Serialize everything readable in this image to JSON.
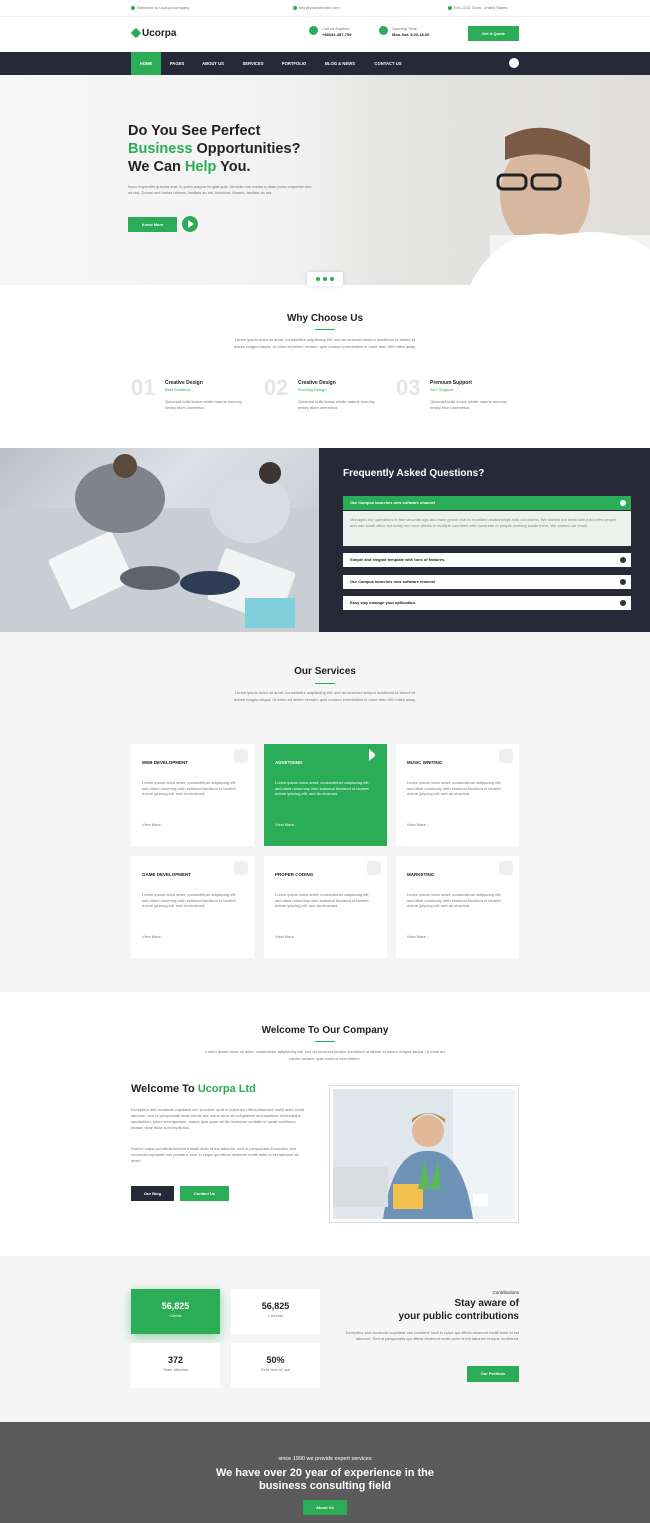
{
  "topbar": {
    "welcome": "Welcome to Ucorpa company",
    "email": "info@yourwebsite.com",
    "address": "Ext-1232, Dock, United States"
  },
  "header": {
    "logo_text": "Ucorpa",
    "call_label": "Call us Anytime",
    "call_value": "+88032-487-799",
    "time_label": "Opening Time",
    "time_value": "Mon-Sat: 9.00-18.00",
    "quote_button": "Get A Quote"
  },
  "nav": {
    "items": [
      "HOME",
      "PAGES",
      "ABOUT US",
      "SERVICES",
      "PORTFOLIO",
      "BLOG & NEWS",
      "CONTACT US"
    ]
  },
  "hero": {
    "line1": "Do You See Perfect",
    "line2_green": "Business",
    "line2_rest": " Opportunities?",
    "line3_a": "We Can ",
    "line3_green": "Help",
    "line3_b": " You.",
    "paragraph": "Nunc imperdiet gravida erat, in porta magna feugiat quis. Aenean non metus a diam porta vulputate nec sit nisi. Donec sed varius ultrices, facilisis ac est, tincidunt, Mauris, facilisis ac est.",
    "know_more": "Know More"
  },
  "why": {
    "title": "Why Choose Us",
    "paragraph": "Lorem ipsum dolor sit amet, consectetur adipisicing elit, sed do eiusmod tempor incididunt ut labore et dolore magna aliqua. Ut enim ad minim veniam, quis nostrud exercitation in more than 800 miles away.",
    "features": [
      {
        "num": "01",
        "title": "Creative Design",
        "sub": "Best Solutions",
        "text": "Quismad nulls lectus mielle mauris eonumy nestry blum onemetus"
      },
      {
        "num": "02",
        "title": "Creative Design",
        "sub": "Running Design",
        "text": "Quismad nulls lectus mielle mauris eonumy nestry blum onemetus"
      },
      {
        "num": "03",
        "title": "Premium Support",
        "sub": "24/7 Support",
        "text": "Quismad nulls lectus mielle mauris eonumy nestry blum onemetus"
      }
    ]
  },
  "faq": {
    "title": "Frequently Asked Questions?",
    "items": [
      "Our Campus launches new software channel",
      "Simple and elegant template with tons of features.",
      "Our Campus launches new software channel",
      "Easy way manage your apllication."
    ],
    "open_answer": "Managed our operations in few seconds ago and have grown due to excellent relationships with our clients. We started out small with just a few people and one small office but today we have offices in multiple countries with hundreds of people working inside them. We started out small."
  },
  "services": {
    "title": "Our Services",
    "paragraph": "Lorem ipsum dolor sit amet, consectetur adipisicing elit, sed do eiusmod tempor incididunt ut labore et dolore magna aliqua. Ut enim ad minim veniam, quis nostrud exercitation in more than 800 miles away.",
    "cards": [
      {
        "title": "WEB DEVELOPMENT",
        "text": "Lorem ipsum dolor amet, consectetuer adipiscing elit, sed diam nonummy nibh euismod tincidunt ut laoreet dolore ipiscing elit, sed do eiusmod.",
        "more": "View More..."
      },
      {
        "title": "ADVETISING",
        "text": "Lorem ipsum dolor amet, consectetuer adipiscing elit, sed diam nonummy nibh euismod tincidunt ut laoreet dolore ipiscing elit, sed do eiusmod.",
        "more": "View More..."
      },
      {
        "title": "MUSIC WRITING",
        "text": "Lorem ipsum dolor amet, consectetuer adipiscing elit, sed diam nonummy nibh euismod tincidunt ut laoreet dolore ipiscing elit, sed do eiusmod.",
        "more": "View More..."
      },
      {
        "title": "GAME DEVELOPMENT",
        "text": "Lorem ipsum dolor amet, consectetuer adipiscing elit, sed diam nonummy nibh euismod tincidunt ut laoreet dolore ipiscing elit, sed do eiusmod.",
        "more": "View More..."
      },
      {
        "title": "PROPER CODING",
        "text": "Lorem ipsum dolor amet, consectetuer adipiscing elit, sed diam nonummy nibh euismod tincidunt ut laoreet dolore ipiscing elit, sed do eiusmod.",
        "more": "View More..."
      },
      {
        "title": "MARKETING",
        "text": "Lorem ipsum dolor amet, consectetuer adipiscing elit, sed diam nonummy nibh euismod tincidunt ut laoreet dolore ipiscing elit, sed do eiusmod.",
        "more": "View More..."
      }
    ]
  },
  "company": {
    "title": "Welcome To Our Company",
    "paragraph": "Lorem ipsum dolor sit amet, consectetur adipisicing elit, sed do eiusmod tempor incididunt ut labore et dolore magna aliqua. Ut enim ad minim veniam, quis nostrud exercitation.",
    "sub_a": "Welcome To ",
    "sub_b": "Ucorpa Ltd",
    "p1": "Excepteur sint occaecat cupidatat non proident, sunt in culpa qui officia deserunt mollit anim id est laborum, sed ut perspiciatis unde omnis iste natus error sit voluptatem accusantium doloremque laudantium, totam rem aperiam, eaque ipsa quae ab illo inventore veritatis et quasi architecto beatae vitae dicta sunt explicabo.",
    "p2": "Sunt in culpa qui officia deserunt mollit anim id est laborum, sed ut perspiciatis Excepteur sint occaecat cupidatat non proident, sunt in culpa qui officia deserunt mollit anim id est laborum sit amet.",
    "blog_button": "Our Blog",
    "contact_button": "Contact Us"
  },
  "counters": {
    "items": [
      {
        "value": "56,825",
        "label": "Clients"
      },
      {
        "value": "56,825",
        "label": "Currents"
      },
      {
        "value": "372",
        "label": "Team Member"
      },
      {
        "value": "50%",
        "label": "First Year of use"
      }
    ],
    "small_title": "Contributions",
    "heading_1": "Stay aware of",
    "heading_2": "your public contributions",
    "paragraph": "Excepteur sint occaecat cupidatat non proident, sunt in culpa qui officia deserunt mollit anim id est laborum. Sed ut perspiciatis qui officia deserunt mollit anim id est laborum tempor incididunt.",
    "portfolio_button": "Our Portfolio"
  },
  "bottom": {
    "since": "since 1990 we provide expert services",
    "heading_1": "We have over 20 year of experience in the",
    "heading_2": "business consulting field",
    "about_button": "About Us"
  },
  "colors": {
    "accent": "#2bac56",
    "dark": "#272838"
  }
}
